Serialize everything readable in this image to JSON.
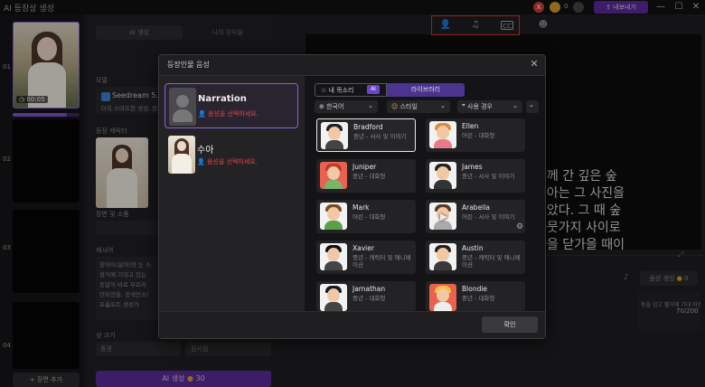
{
  "app": {
    "title": "AI 등장상 생성",
    "export_label": "내보내기",
    "coin_count": "0",
    "close_badge": "X"
  },
  "scenes": [
    {
      "num": "01",
      "time": "00:05"
    },
    {
      "num": "02"
    },
    {
      "num": "03"
    },
    {
      "num": "04"
    }
  ],
  "scene_strip": {
    "add_label": "+ 장면 추가"
  },
  "mid": {
    "tab_ai": "AI 생성",
    "tab_mine": "나의 장미들",
    "model_label": "모델",
    "model_name": "Seedream 5.0",
    "model_desc": "더욱 스마트한 생성, 원",
    "char_label": "등장 캐릭터",
    "scene_label": "장면 및 소품",
    "scene_placeholder": "혼자 장면에",
    "prompt_label": "제시어",
    "prompt_text": "창아이(윤아)의 눈 소\n할거에 기대고 있는\n동달이 바로 부르러\n련되었을, 공색인소(\n프롬프트 생성가",
    "size_label": "샷 크기",
    "input_a": "중경",
    "input_b": "원시점",
    "generate_label": "AI 생성",
    "generate_cost": "30"
  },
  "preview": {
    "text": "함께 간 깊은 숲\n수아는 그 사진을\n보았다. 그 때 숲\n나뭇가지 사이로\n얀을 닫가을 때이",
    "voice_gen_label": "음성 생성",
    "voice_gen_cost": "0",
    "script_snippet": "동을 입고 휠거에 기대 따뜻한 오후 햇살을",
    "char_count": "70/200"
  },
  "toolbar": {
    "icons": [
      "add-voice-icon",
      "music-icon",
      "cc-icon"
    ]
  },
  "modal": {
    "title": "등장인물 음성",
    "close": "✕",
    "confirm_label": "확인",
    "roles": [
      {
        "name": "Narration",
        "warning": "음성을 선택하세요."
      },
      {
        "name": "수아",
        "warning": "음성을 선택하세요."
      }
    ],
    "tab_my_voice": "내 목소리",
    "tab_my_voice_badge": "AI",
    "tab_library": "라이브러리",
    "filters": {
      "language": "한국어",
      "style": "스타일",
      "use_case": "사용 경우"
    },
    "voices": [
      {
        "name": "Bradford",
        "desc": "중년 - 서사 및 이야기",
        "selected": true
      },
      {
        "name": "Ellen",
        "desc": "어린 - 대화형"
      },
      {
        "name": "Juniper",
        "desc": "중년 - 대화형"
      },
      {
        "name": "James",
        "desc": "중년 - 서사 및 이야기"
      },
      {
        "name": "Mark",
        "desc": "어린 - 대화형"
      },
      {
        "name": "Arabella",
        "desc": "어린 - 서사 및 이야기"
      },
      {
        "name": "Xavier",
        "desc": "중년 - 캐릭터 및 애니메이션"
      },
      {
        "name": "Austin",
        "desc": "중년 - 캐릭터 및 애니메이션"
      },
      {
        "name": "Jarnathan",
        "desc": "중년 - 대화형"
      },
      {
        "name": "Blondie",
        "desc": "중년 - 대화형"
      }
    ]
  },
  "colors": {
    "accent": "#7c55c9",
    "warning": "#e04545",
    "export": "#5b2a9e",
    "highlight_box": "#e0312b"
  }
}
